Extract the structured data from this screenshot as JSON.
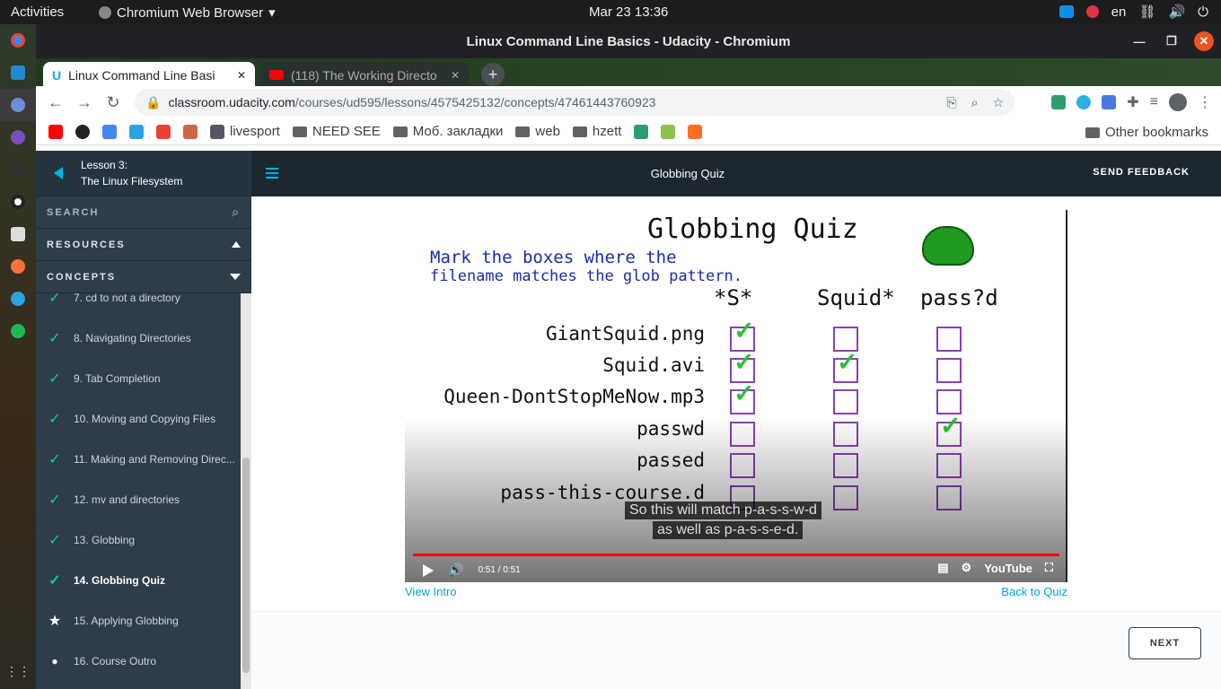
{
  "system": {
    "activities": "Activities",
    "app": "Chromium Web Browser",
    "clock": "Mar 23  13:36",
    "lang": "en"
  },
  "window": {
    "title": "Linux Command Line Basics - Udacity - Chromium"
  },
  "tabs": [
    {
      "label": "Linux Command Line Basi"
    },
    {
      "label": "(118) The Working Directo"
    }
  ],
  "address": {
    "host": "classroom.udacity.com",
    "path": "/courses/ud595/lessons/4575425132/concepts/47461443760923"
  },
  "bookmarks": {
    "items": [
      "livesport",
      "NEED SEE",
      "Моб. закладки",
      "web",
      "hzett"
    ],
    "other": "Other bookmarks"
  },
  "sidebar": {
    "lesson_num": "Lesson 3:",
    "lesson_title": "The Linux Filesystem",
    "search": "SEARCH",
    "resources": "RESOURCES",
    "concepts": "CONCEPTS",
    "items": [
      {
        "label": "7. cd to not a directory",
        "state": "done"
      },
      {
        "label": "8. Navigating Directories",
        "state": "done"
      },
      {
        "label": "9. Tab Completion",
        "state": "done"
      },
      {
        "label": "10. Moving and Copying Files",
        "state": "done"
      },
      {
        "label": "11. Making and Removing Direc...",
        "state": "done"
      },
      {
        "label": "12. mv and directories",
        "state": "done"
      },
      {
        "label": "13. Globbing",
        "state": "done"
      },
      {
        "label": "14. Globbing Quiz",
        "state": "current"
      },
      {
        "label": "15. Applying Globbing",
        "state": "star"
      },
      {
        "label": "16. Course Outro",
        "state": "dot"
      }
    ]
  },
  "header": {
    "title": "Globbing Quiz",
    "feedback": "SEND FEEDBACK"
  },
  "video": {
    "heading": "Globbing Quiz",
    "instruction1": "Mark the boxes where the",
    "instruction2": "filename matches the glob pattern.",
    "patterns": [
      "*S*",
      "Squid*",
      "pass?d"
    ],
    "filenames": [
      "GiantSquid.png",
      "Squid.avi",
      "Queen-DontStopMeNow.mp3",
      "passwd",
      "passed",
      "pass-this-course.d"
    ],
    "checked": [
      [
        true,
        false,
        false
      ],
      [
        true,
        true,
        false
      ],
      [
        true,
        false,
        false
      ],
      [
        false,
        false,
        true
      ],
      [
        false,
        false,
        false
      ],
      [
        false,
        false,
        false
      ]
    ],
    "caption1": "So this will match p-a-s-s-w-d",
    "caption2": "as well as p-a-s-s-e-d.",
    "time": "0:51 / 0:51",
    "brand": "YouTube",
    "progress": 1.0
  },
  "links": {
    "intro": "View Intro",
    "back": "Back to Quiz"
  },
  "footer": {
    "next": "NEXT"
  },
  "colors": {
    "accent": "#02b3e4",
    "check": "#02ccba",
    "boxes": "#8e3fb4",
    "ticks": "#2bc035"
  }
}
